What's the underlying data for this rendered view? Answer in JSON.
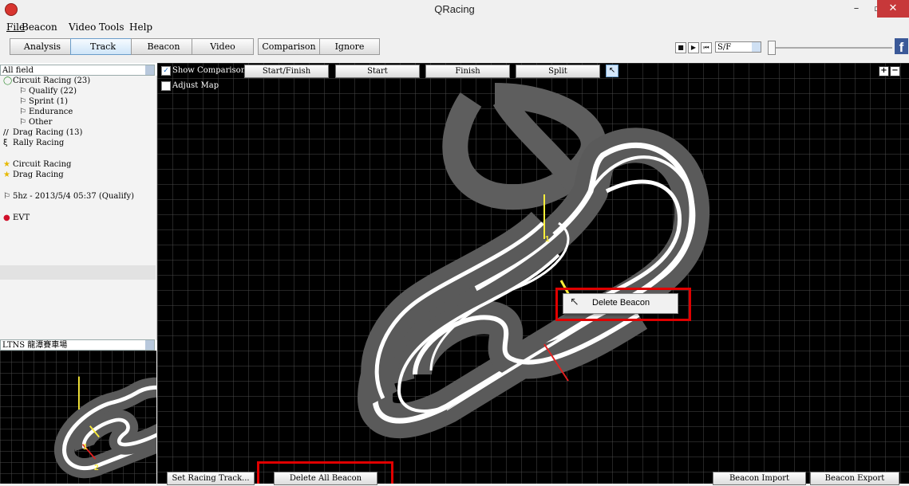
{
  "window": {
    "title": "QRacing",
    "minimize": "–",
    "maximize": "▫",
    "close": "✕"
  },
  "menu": [
    "File",
    "Beacon",
    "Video",
    "Tools",
    "Help"
  ],
  "tabs": [
    "Analysis",
    "Track",
    "Beacon",
    "Video",
    "Comparison",
    "Ignore"
  ],
  "active_tab": "Track",
  "media": {
    "stop": "■",
    "play": "▶",
    "prev": "⏮",
    "next": "⏭",
    "mode_value": "S/F"
  },
  "facebook": "f",
  "left": {
    "filter_value": "All field",
    "tree": [
      {
        "label": "Circuit Racing (23)",
        "icon": "◯"
      },
      {
        "label": "Qualify (22)",
        "icon": "⚐"
      },
      {
        "label": "Sprint (1)",
        "icon": "⚐"
      },
      {
        "label": "Endurance",
        "icon": "⚐"
      },
      {
        "label": "Other",
        "icon": "⚐"
      },
      {
        "label": "Drag Racing (13)",
        "icon": "//"
      },
      {
        "label": "Rally Racing",
        "icon": "ξ"
      },
      {
        "label": "Circuit Racing",
        "icon": "★"
      },
      {
        "label": "Drag Racing",
        "icon": "★"
      },
      {
        "label": "5hz - 2013/5/4 05:37 (Qualify)",
        "icon": "⚐"
      },
      {
        "label": "EVT",
        "icon": "●"
      }
    ],
    "track_value": "LTNS 龍潭賽車場"
  },
  "toolbar": {
    "show_comparison": "Show Comparison",
    "adjust_map": "Adjust Map",
    "start_finish": "Start/Finish",
    "start": "Start",
    "finish": "Finish",
    "split": "Split",
    "zoom_in": "+",
    "zoom_out": "−"
  },
  "context_menu": {
    "delete_beacon": "Delete Beacon"
  },
  "beacons": [
    "1",
    "2"
  ],
  "bottom": {
    "set_track": "Set Racing Track...",
    "delete_all": "Delete All Beacon",
    "beacon_import": "Beacon Import",
    "beacon_export": "Beacon Export"
  }
}
